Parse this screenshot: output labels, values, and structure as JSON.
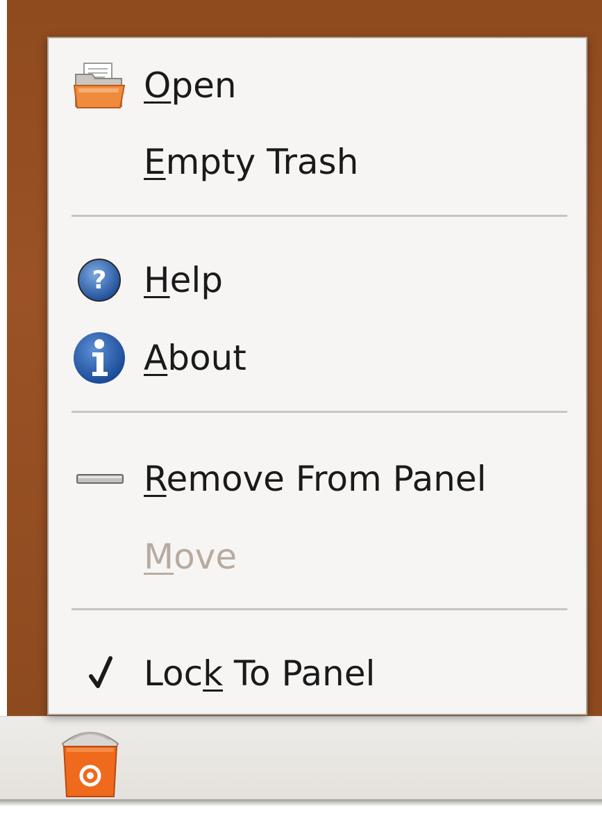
{
  "menu": {
    "items": [
      {
        "id": "open",
        "pre": "",
        "u": "O",
        "post": "pen",
        "icon": "folder-open-icon",
        "enabled": true
      },
      {
        "id": "empty-trash",
        "pre": "",
        "u": "E",
        "post": "mpty Trash",
        "icon": "",
        "enabled": true
      },
      {
        "id": "help",
        "pre": "",
        "u": "H",
        "post": "elp",
        "icon": "help-icon",
        "enabled": true
      },
      {
        "id": "about",
        "pre": "",
        "u": "A",
        "post": "bout",
        "icon": "info-icon",
        "enabled": true
      },
      {
        "id": "remove",
        "pre": "",
        "u": "R",
        "post": "emove From Panel",
        "icon": "remove-icon",
        "enabled": true
      },
      {
        "id": "move",
        "pre": "",
        "u": "M",
        "post": "ove",
        "icon": "",
        "enabled": false
      },
      {
        "id": "lock",
        "pre": "Loc",
        "u": "k",
        "post": " To Panel",
        "icon": "checkmark-icon",
        "enabled": true,
        "checked": true
      }
    ]
  },
  "panel": {
    "applet_icon": "trash-icon"
  },
  "colors": {
    "desktop": "#9a5226",
    "menu_bg": "#f6f5f3",
    "disabled_text": "#b7aba1"
  }
}
